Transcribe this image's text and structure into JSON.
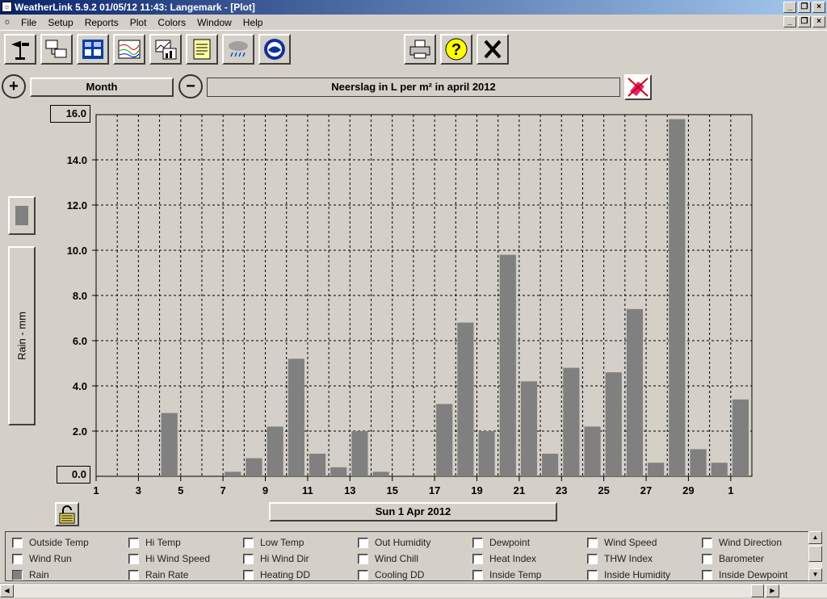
{
  "window": {
    "title": "WeatherLink 5.9.2  01/05/12  11:43: Langemark - [Plot]",
    "min_label": "_",
    "restore_label": "❐",
    "close_label": "×"
  },
  "menu": [
    "File",
    "Setup",
    "Reports",
    "Plot",
    "Colors",
    "Window",
    "Help"
  ],
  "toolbar": {
    "buttons": [
      "station-icon",
      "download-icon",
      "bulletin-icon",
      "summary-icon",
      "chart-icon",
      "notes-icon",
      "weather-icon",
      "noaa-icon",
      "print-icon",
      "help-icon",
      "close-icon"
    ]
  },
  "controls": {
    "zoom_in": "+",
    "zoom_out": "−",
    "period": "Month",
    "plot_title": "Neerslag in L per m² in april 2012",
    "ymax": "16.0",
    "ymin": "0.0",
    "ylabel": "Rain - mm",
    "date": "Sun 1 Apr 2012"
  },
  "chart_data": {
    "type": "bar",
    "title": "Neerslag in L per m² in april 2012",
    "ylabel": "Rain - mm",
    "xlabel": "Sun 1 Apr 2012",
    "ylim": [
      0,
      16
    ],
    "grid": true,
    "color": "#808080",
    "yticks": [
      "0.0",
      "2.0",
      "4.0",
      "6.0",
      "8.0",
      "10.0",
      "12.0",
      "14.0",
      "16.0"
    ],
    "xticks": [
      "1",
      "3",
      "5",
      "7",
      "9",
      "11",
      "13",
      "15",
      "17",
      "19",
      "21",
      "23",
      "25",
      "27",
      "29",
      "1"
    ],
    "categories": [
      "1",
      "2",
      "3",
      "4",
      "5",
      "6",
      "7",
      "8",
      "9",
      "10",
      "11",
      "12",
      "13",
      "14",
      "15",
      "16",
      "17",
      "18",
      "19",
      "20",
      "21",
      "22",
      "23",
      "24",
      "25",
      "26",
      "27",
      "28",
      "29",
      "30"
    ],
    "values": [
      0,
      0,
      0,
      2.8,
      0,
      0,
      0.2,
      0.8,
      2.2,
      5.2,
      1.0,
      0.4,
      2.0,
      0.2,
      0,
      0,
      3.2,
      6.8,
      2.0,
      9.8,
      4.2,
      1.0,
      4.8,
      2.2,
      4.6,
      7.4,
      0.6,
      15.8,
      1.2,
      0.6,
      3.4
    ]
  },
  "legend": {
    "rows": [
      [
        "Outside Temp",
        "Hi Temp",
        "Low Temp",
        "Out Humidity",
        "Dewpoint",
        "Wind Speed",
        "Wind Direction"
      ],
      [
        "Wind Run",
        "Hi Wind Speed",
        "Hi Wind Dir",
        "Wind Chill",
        "Heat Index",
        "THW Index",
        "Barometer"
      ],
      [
        "Rain",
        "Rain Rate",
        "Heating DD",
        "Cooling DD",
        "Inside Temp",
        "Inside Humidity",
        "Inside Dewpoint"
      ]
    ],
    "checked": [
      "Rain"
    ]
  },
  "scroll": {
    "up": "▲",
    "down": "▼",
    "left": "◀",
    "right": "▶"
  }
}
